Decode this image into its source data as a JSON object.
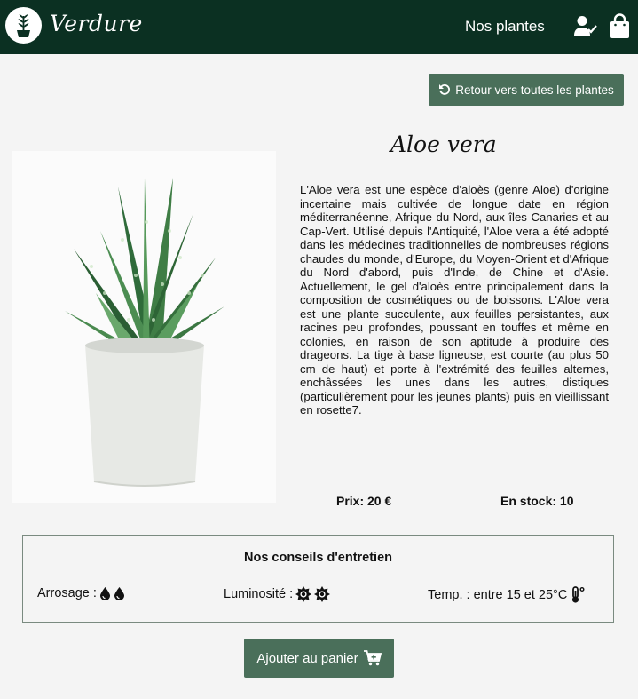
{
  "header": {
    "brand": "Verdure",
    "nav_label": "Nos plantes",
    "logo_icon": "plant-pot-icon",
    "user_icon": "user-check-icon",
    "bag_icon": "shopping-bag-icon",
    "bg_color": "#0b3022"
  },
  "back_button": {
    "label": "Retour vers toutes les plantes",
    "icon": "undo-icon"
  },
  "product": {
    "name": "Aloe vera",
    "description": "L'Aloe vera est une espèce d'aloès (genre Aloe) d'origine incertaine mais cultivée de longue date en région méditerranéenne, Afrique du Nord, aux îles Canaries et au Cap-Vert. Utilisé depuis l'Antiquité, l'Aloe vera a été adopté dans les médecines traditionnelles de nombreuses régions chaudes du monde, d'Europe, du Moyen-Orient et d'Afrique du Nord d'abord, puis d'Inde, de Chine et d'Asie. Actuellement, le gel d'aloès entre principalement dans la composition de cosmétiques ou de boissons. L'Aloe vera est une plante succulente, aux feuilles persistantes, aux racines peu profondes, poussant en touffes et même en colonies, en raison de son aptitude à produire des drageons. La tige à base ligneuse, est courte (au plus 50 cm de haut) et porte à l'extrémité des feuilles alternes, enchâssées les unes dans les autres, distiques (particulièrement pour les jeunes plants) puis en vieillissant en rosette7.",
    "price": "Prix: 20 €",
    "stock": "En stock: 10"
  },
  "care": {
    "title": "Nos conseils d'entretien",
    "watering_label": "Arrosage :",
    "watering_level": 2,
    "light_label": "Luminosité :",
    "light_level": 2,
    "temp_label": "Temp. : entre 15 et 25°C",
    "icons": [
      "water-drop-icon",
      "sun-icon",
      "thermometer-icon"
    ]
  },
  "cart_button": {
    "label": "Ajouter au panier",
    "icon": "cart-plus-icon"
  },
  "colors": {
    "accent": "#4a6f5a",
    "header": "#0b3022",
    "background": "#f4f4f4"
  }
}
